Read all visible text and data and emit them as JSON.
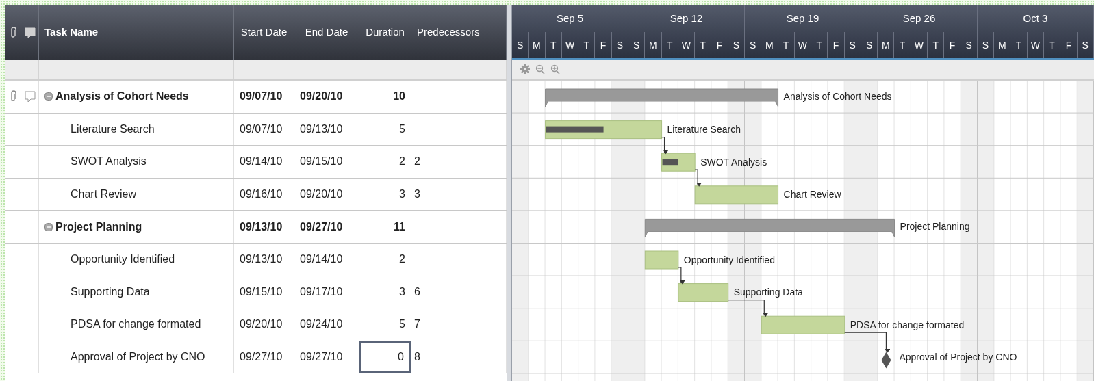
{
  "header": {
    "task_name": "Task Name",
    "start_date": "Start Date",
    "end_date": "End Date",
    "duration": "Duration",
    "predecessors": "Predecessors"
  },
  "timeline": {
    "weeks": [
      "Sep 5",
      "Sep 12",
      "Sep 19",
      "Sep 26",
      "Oct 3"
    ],
    "days": [
      "S",
      "M",
      "T",
      "W",
      "T",
      "F",
      "S",
      "S",
      "M",
      "T",
      "W",
      "T",
      "F",
      "S",
      "S",
      "M",
      "T",
      "W",
      "T",
      "F",
      "S",
      "S",
      "M",
      "T",
      "W",
      "T",
      "F",
      "S",
      "S",
      "M",
      "T",
      "W",
      "T",
      "F",
      "S"
    ]
  },
  "rows": [
    {
      "kind": "summary",
      "expanded": true,
      "has_attachment": true,
      "has_comment": true,
      "name": "Analysis of Cohort Needs",
      "start_date": "09/07/10",
      "end_date": "09/20/10",
      "duration": "10",
      "bar_label": "Analysis of Cohort Needs",
      "duration_focused": false
    },
    {
      "kind": "task",
      "has_attachment": false,
      "has_comment": false,
      "name": "Literature Search",
      "start_date": "09/07/10",
      "end_date": "09/13/10",
      "duration": "5",
      "bar_label": "Literature Search",
      "level": 0.5,
      "duration_focused": false
    },
    {
      "kind": "task",
      "has_attachment": false,
      "has_comment": false,
      "name": "SWOT Analysis",
      "start_date": "09/14/10",
      "end_date": "09/15/10",
      "duration": "2",
      "predecessors": "2",
      "bar_label": "SWOT Analysis",
      "level": 0.5,
      "duration_focused": false
    },
    {
      "kind": "task",
      "has_attachment": false,
      "has_comment": false,
      "name": "Chart Review",
      "start_date": "09/16/10",
      "end_date": "09/20/10",
      "duration": "3",
      "predecessors": "3",
      "bar_label": "Chart Review",
      "duration_focused": false
    },
    {
      "kind": "summary",
      "expanded": true,
      "has_attachment": false,
      "has_comment": false,
      "name": "Project Planning",
      "start_date": "09/13/10",
      "end_date": "09/27/10",
      "duration": "11",
      "bar_label": "Project Planning",
      "duration_focused": false
    },
    {
      "kind": "task",
      "has_attachment": false,
      "has_comment": false,
      "name": "Opportunity Identified",
      "start_date": "09/13/10",
      "end_date": "09/14/10",
      "duration": "2",
      "bar_label": "Opportunity Identified",
      "duration_focused": false
    },
    {
      "kind": "task",
      "has_attachment": false,
      "has_comment": false,
      "name": "Supporting Data",
      "start_date": "09/15/10",
      "end_date": "09/17/10",
      "duration": "3",
      "predecessors": "6",
      "bar_label": "Supporting Data",
      "duration_focused": false
    },
    {
      "kind": "task",
      "has_attachment": false,
      "has_comment": false,
      "name": "PDSA for change formated",
      "start_date": "09/20/10",
      "end_date": "09/24/10",
      "duration": "5",
      "predecessors": "7",
      "bar_label": "PDSA for change formated",
      "duration_focused": false
    },
    {
      "kind": "milestone",
      "has_attachment": false,
      "has_comment": false,
      "name": "Approval of Project by CNO",
      "start_date": "09/27/10",
      "end_date": "09/27/10",
      "duration": "0",
      "predecessors": "8",
      "bar_label": "Approval of Project by CNO",
      "duration_focused": true
    }
  ]
}
